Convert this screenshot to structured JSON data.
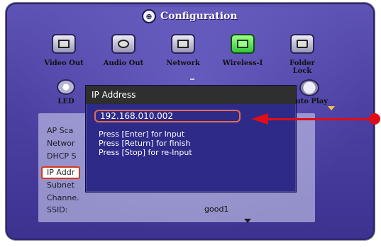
{
  "header": {
    "title": "Configuration"
  },
  "categories": [
    {
      "label": "Video Out",
      "icon": "video-out-icon"
    },
    {
      "label": "Audio Out",
      "icon": "audio-out-icon"
    },
    {
      "label": "Network",
      "icon": "network-icon"
    },
    {
      "label": "Wireless-I",
      "icon": "wireless-icon",
      "selected": true
    },
    {
      "label": "Folder Lock",
      "icon": "folder-lock-icon"
    }
  ],
  "extra_categories": [
    {
      "label": "LED",
      "icon": "led-icon"
    },
    {
      "label": "uto Play",
      "icon": "auto-play-icon"
    }
  ],
  "settings": [
    {
      "label": "AP Sca"
    },
    {
      "label": "Networ"
    },
    {
      "label": "DHCP S"
    },
    {
      "label": "IP Addr",
      "selected": true
    },
    {
      "label": "Subnet"
    },
    {
      "label": "Channe."
    },
    {
      "label": "SSID:"
    }
  ],
  "ssid_value": "good1",
  "dialog": {
    "title": "IP Address",
    "value": "192.168.010.002",
    "help_lines": [
      "Press [Enter] for Input",
      "Press [Return] for finish",
      "Press [Stop] for re-Input"
    ]
  },
  "colors": {
    "accent": "#e10d16",
    "dialog_bg": "#2e2a88",
    "bezel": "#5e54b6"
  }
}
